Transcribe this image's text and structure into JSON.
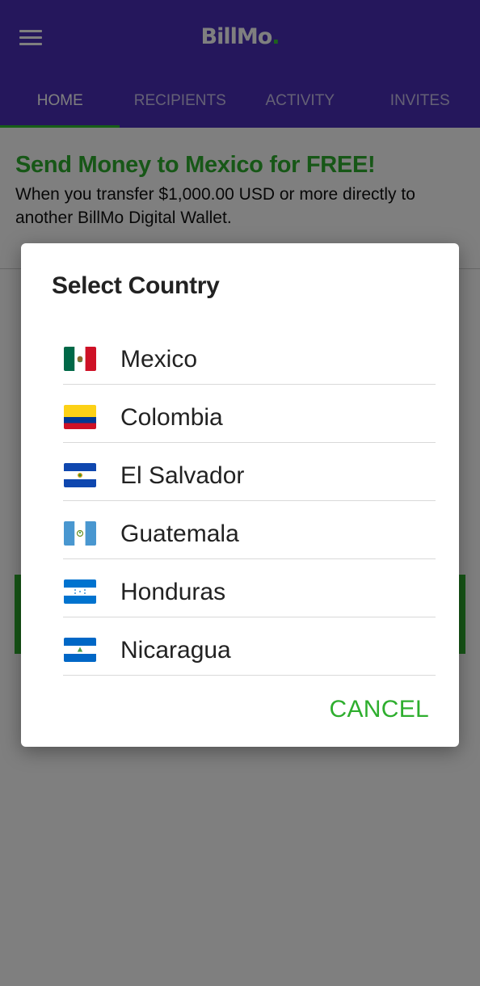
{
  "app": {
    "logo_main": "BillMo",
    "logo_dot": ".",
    "tabs": [
      {
        "label": "HOME",
        "active": true
      },
      {
        "label": "RECIPIENTS",
        "active": false
      },
      {
        "label": "ACTIVITY",
        "active": false
      },
      {
        "label": "INVITES",
        "active": false
      }
    ],
    "promo": {
      "title": "Send Money to Mexico for FREE!",
      "text": "When you transfer $1,000.00 USD or more directly to another BillMo Digital Wallet."
    }
  },
  "dialog": {
    "title": "Select Country",
    "countries": [
      {
        "name": "Mexico",
        "flag": "mexico-flag-icon"
      },
      {
        "name": "Colombia",
        "flag": "colombia-flag-icon"
      },
      {
        "name": "El Salvador",
        "flag": "el-salvador-flag-icon"
      },
      {
        "name": "Guatemala",
        "flag": "guatemala-flag-icon"
      },
      {
        "name": "Honduras",
        "flag": "honduras-flag-icon"
      },
      {
        "name": "Nicaragua",
        "flag": "nicaragua-flag-icon"
      }
    ],
    "cancel_label": "CANCEL"
  },
  "colors": {
    "brand_purple": "#4a2eb8",
    "accent_green": "#2eae2e",
    "scrim": "rgba(0,0,0,0.5)"
  }
}
